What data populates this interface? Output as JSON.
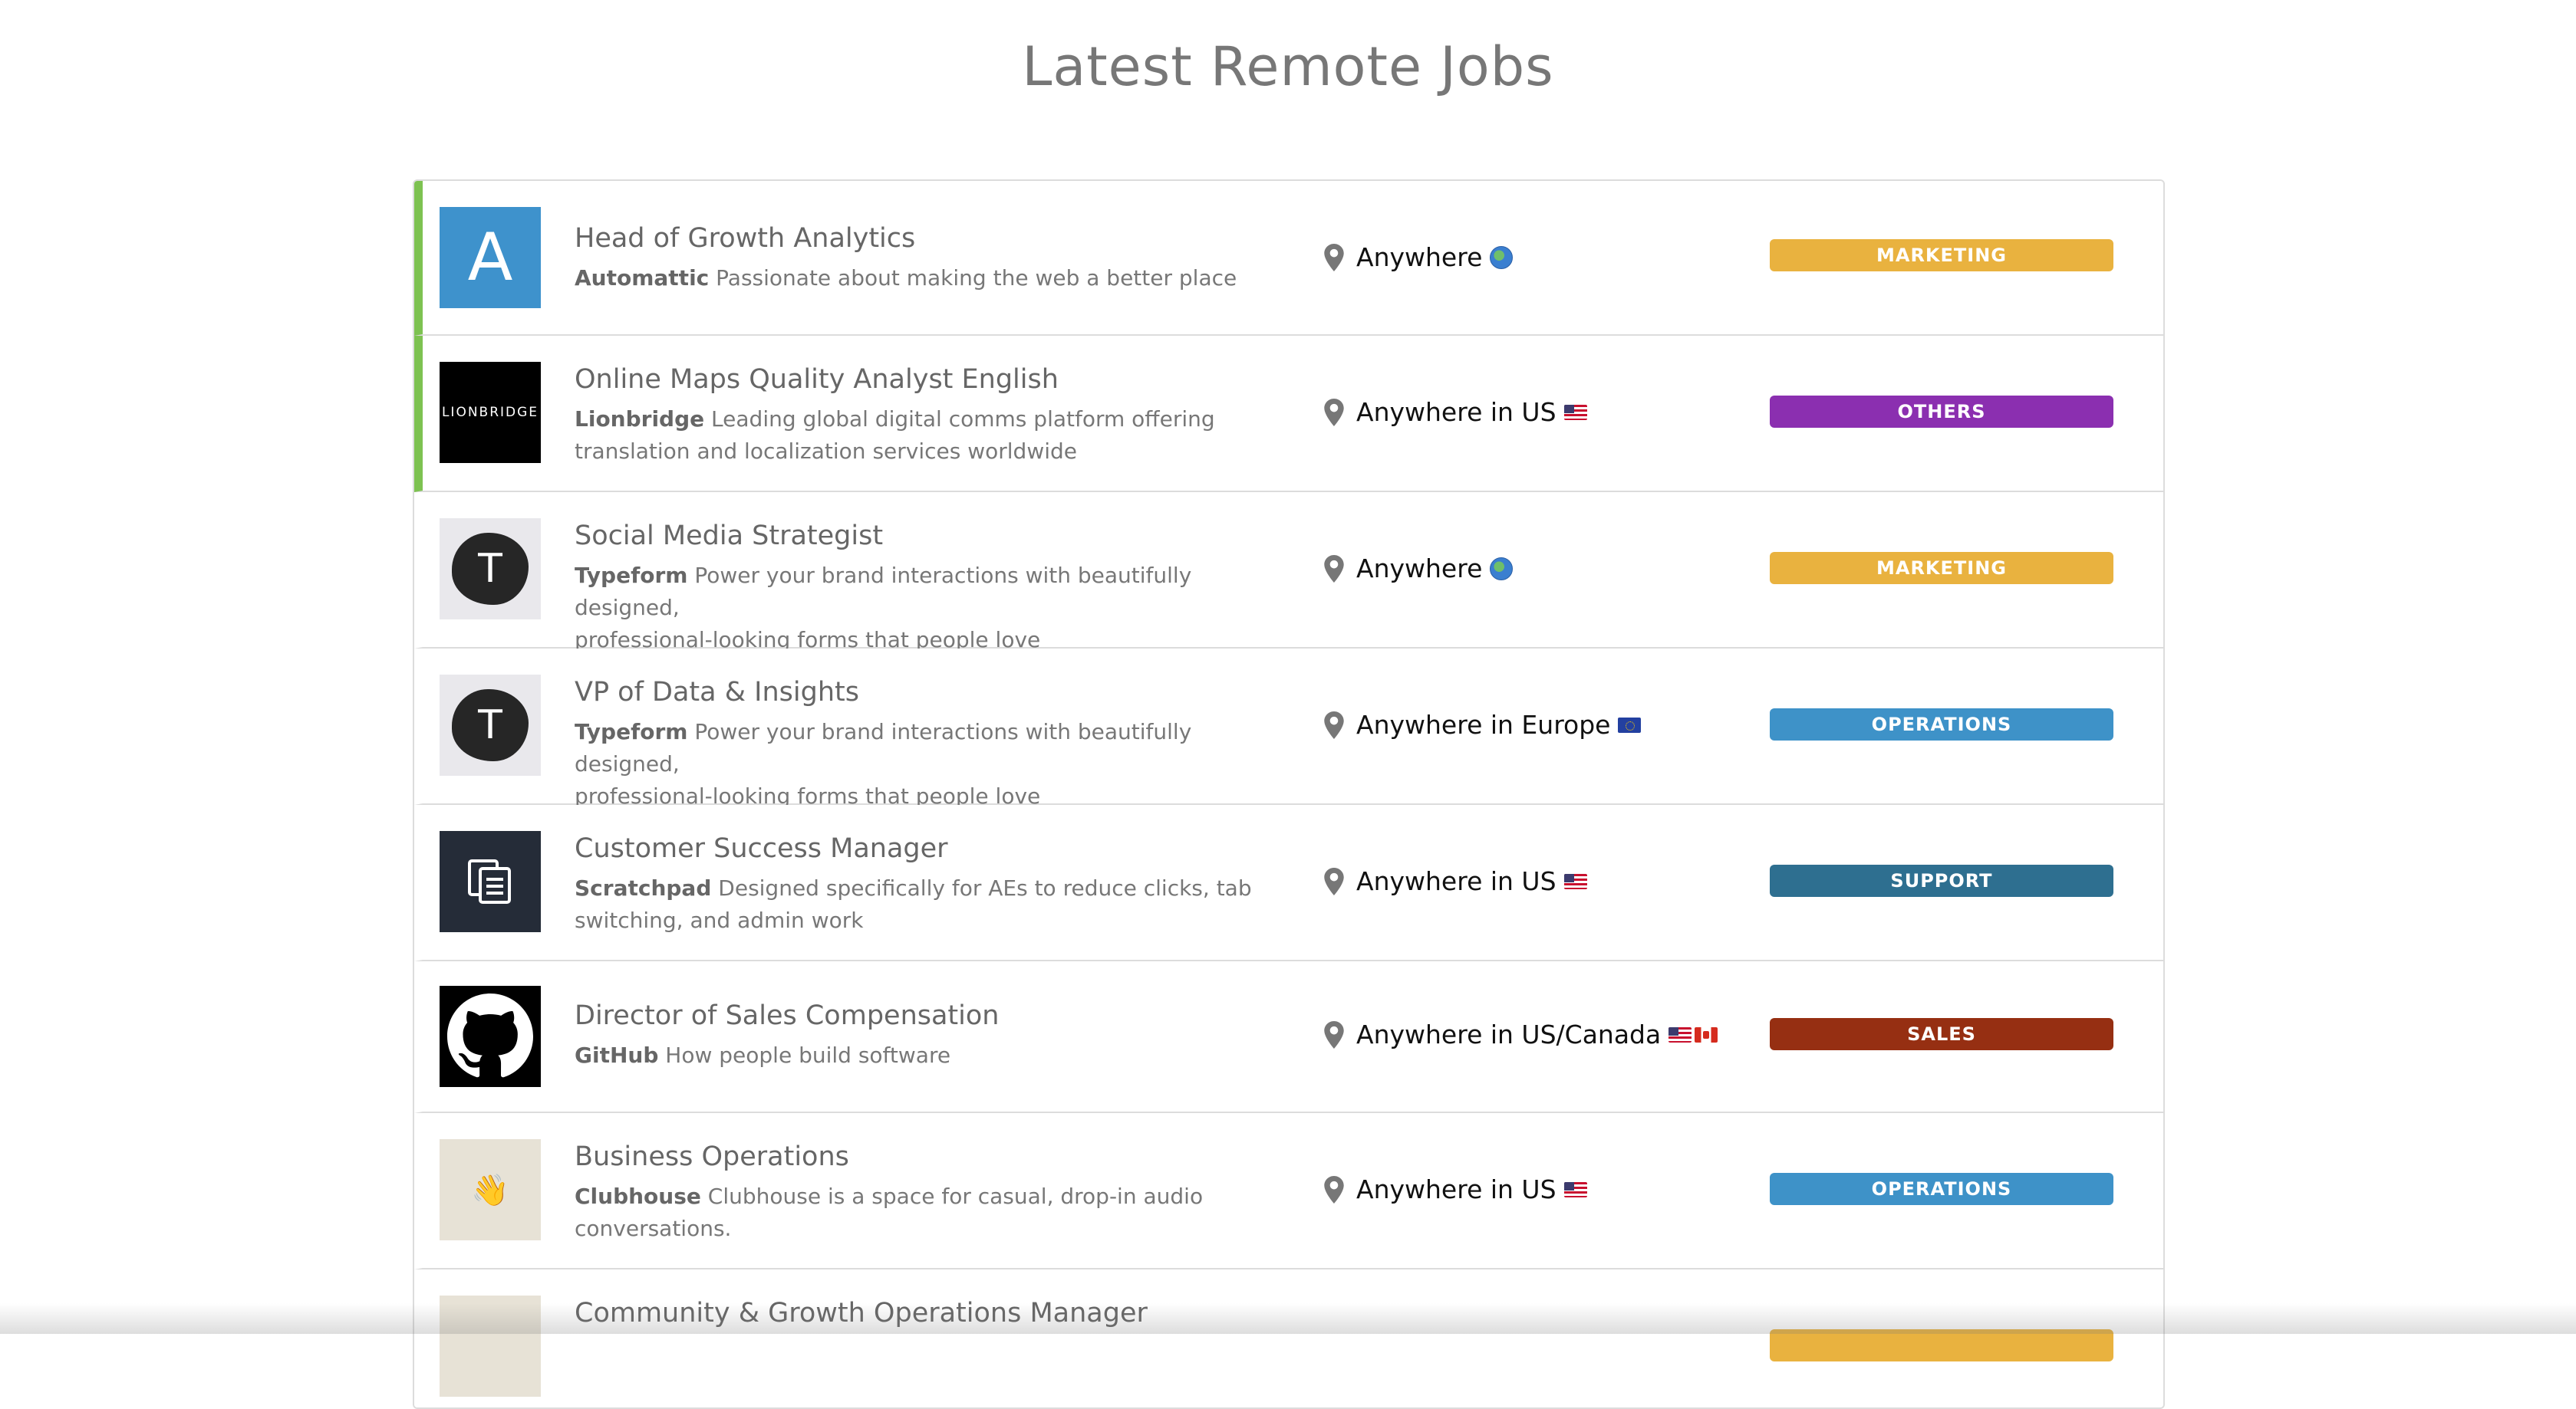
{
  "page": {
    "title": "Latest Remote Jobs"
  },
  "jobs": [
    {
      "title": "Head of Growth Analytics",
      "company": "Automattic",
      "description": "Passionate about making the web a better place",
      "description_line2": "",
      "location": "Anywhere",
      "location_icon": "globe",
      "category": "MARKETING",
      "category_color": "#e9b23f",
      "featured": true,
      "logo": "automattic-logo",
      "logo_text": "A"
    },
    {
      "title": "Online Maps Quality Analyst English",
      "company": "Lionbridge",
      "description": "Leading global digital comms platform offering",
      "description_line2": "translation and localization services worldwide",
      "location": "Anywhere in US",
      "location_icon": "us-flag",
      "category": "OTHERS",
      "category_color": "#8b2fb0",
      "featured": true,
      "logo": "lionbridge-logo",
      "logo_text": "LIONBRIDGE"
    },
    {
      "title": "Social Media Strategist",
      "company": "Typeform",
      "description": "Power your brand interactions with beautifully designed,",
      "description_line2": "professional-looking forms that people love",
      "location": "Anywhere",
      "location_icon": "globe",
      "category": "MARKETING",
      "category_color": "#e9b23f",
      "featured": false,
      "logo": "typeform-logo",
      "logo_text": "T"
    },
    {
      "title": "VP of Data & Insights",
      "company": "Typeform",
      "description": "Power your brand interactions with beautifully designed,",
      "description_line2": "professional-looking forms that people love",
      "location": "Anywhere in Europe",
      "location_icon": "eu-flag",
      "category": "OPERATIONS",
      "category_color": "#3e92c8",
      "featured": false,
      "logo": "typeform-logo",
      "logo_text": "T"
    },
    {
      "title": "Customer Success Manager",
      "company": "Scratchpad",
      "description": "Designed specifically for AEs to reduce clicks, tab",
      "description_line2": "switching, and admin work",
      "location": "Anywhere in US",
      "location_icon": "us-flag",
      "category": "SUPPORT",
      "category_color": "#2e6f90",
      "featured": false,
      "logo": "scratchpad-logo",
      "logo_text": ""
    },
    {
      "title": "Director of Sales Compensation",
      "company": "GitHub",
      "description": "How people build software",
      "description_line2": "",
      "location": "Anywhere in US/Canada",
      "location_icon": "us-ca-flags",
      "category": "SALES",
      "category_color": "#962f12",
      "featured": false,
      "logo": "github-logo",
      "logo_text": ""
    },
    {
      "title": "Business Operations",
      "company": "Clubhouse",
      "description": "Clubhouse is a space for casual, drop-in audio",
      "description_line2": "conversations.",
      "location": "Anywhere in US",
      "location_icon": "us-flag",
      "category": "OPERATIONS",
      "category_color": "#3e92c8",
      "featured": false,
      "logo": "clubhouse-logo",
      "logo_text": "👋"
    },
    {
      "title": "Community & Growth Operations Manager",
      "company": "",
      "description": "",
      "description_line2": "",
      "location": "",
      "location_icon": "",
      "category": "",
      "category_color": "#e9b23f",
      "featured": false,
      "logo": "clubhouse-logo",
      "logo_text": ""
    }
  ]
}
